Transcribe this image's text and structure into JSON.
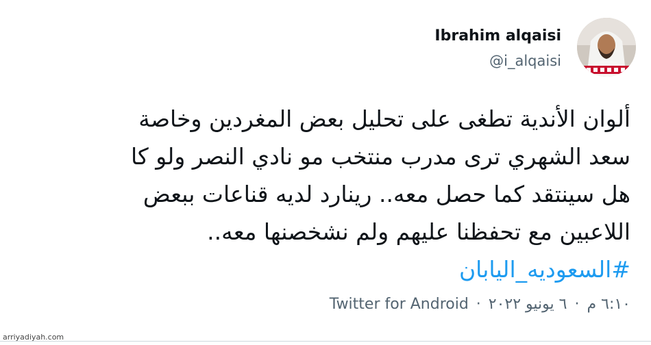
{
  "author": {
    "display_name": "Ibrahim alqaisi",
    "handle": "@i_alqaisi"
  },
  "tweet": {
    "lines": [
      "ألوان الأندية تطغى على تحليل بعض المغردين وخاصة",
      "سعد الشهري ترى مدرب منتخب مو نادي النصر ولو كا",
      "هل سينتقد كما حصل معه.. رينارد لديه قناعات ببعض",
      "اللاعبين مع تحفظنا عليهم ولم نشخصنها معه.."
    ],
    "hashtag": "#السعوديه_اليابان"
  },
  "meta": {
    "time": "٦:١٠ م",
    "date": "٦ يونيو ٢٠٢٢",
    "separator": "·",
    "source": "Twitter for Android"
  },
  "watermark": "arriyadiyah.com",
  "colors": {
    "link": "#1d9bf0",
    "text": "#0f1419",
    "secondary": "#536471"
  }
}
